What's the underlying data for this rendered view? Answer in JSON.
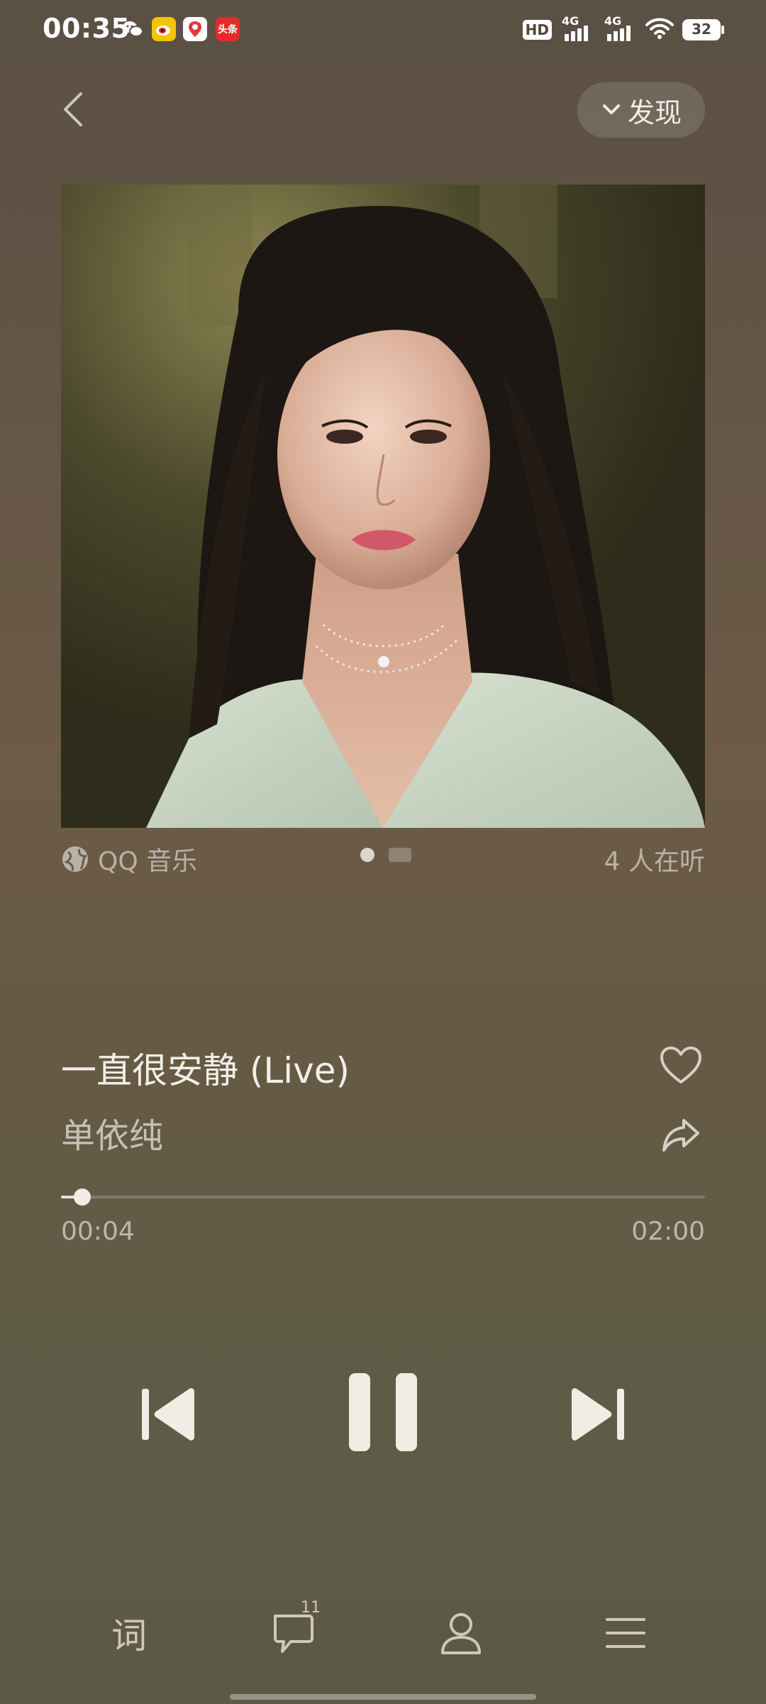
{
  "status_bar": {
    "time": "00:35",
    "app_icons": [
      "wechat-icon",
      "weibo-icon",
      "map-pin-app-icon",
      "toutiao-icon"
    ],
    "toutiao_text": "头条",
    "hd_label": "HD",
    "sim1_label": "4G",
    "sim2_label": "4G",
    "battery": "32"
  },
  "header": {
    "back_icon": "chevron-left-icon",
    "discover_label": "发现"
  },
  "album": {
    "source_label": "QQ 音乐",
    "listeners": "4 人在听",
    "pages": 2,
    "active_page": 1
  },
  "song": {
    "title": "一直很安静 (Live)",
    "artist": "单依纯"
  },
  "progress": {
    "elapsed": "00:04",
    "total": "02:00",
    "fraction": 0.0333
  },
  "controls": {
    "prev_icon": "skip-previous-icon",
    "pause_icon": "pause-icon",
    "next_icon": "skip-next-icon"
  },
  "bottom_bar": {
    "lyrics_label": "词",
    "comment_count": "11",
    "comments_icon": "comment-icon",
    "artist_icon": "person-icon",
    "playlist_icon": "menu-list-icon"
  },
  "colors": {
    "background_top": "#5a5044",
    "background_bottom": "#5b5a45",
    "text_primary": "#f3efe8",
    "text_secondary": "#bdb6ab"
  }
}
